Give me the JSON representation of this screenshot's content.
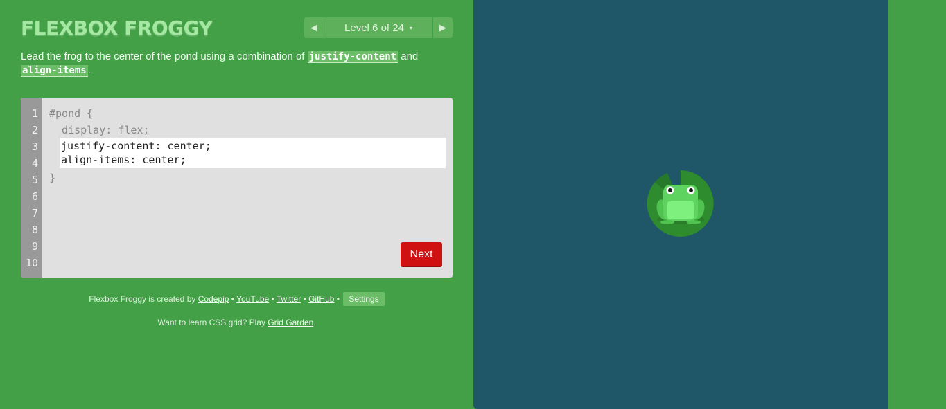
{
  "app": {
    "title": "FLEXBOX FROGGY",
    "level": {
      "label": "Level 6 of 24",
      "caret": "▾",
      "prev_icon": "◀",
      "next_icon": "▶"
    }
  },
  "instructions": {
    "text_1": "Lead the frog to the center of the pond using a combination of ",
    "code_1": "justify-content",
    "text_2": " and ",
    "code_2": "align-items",
    "text_3": "."
  },
  "editor": {
    "line_numbers": [
      "1",
      "2",
      "3",
      "4",
      "5",
      "6",
      "7",
      "8",
      "9",
      "10"
    ],
    "line_1": "#pond {",
    "line_2": "  display: flex;",
    "input_value": "justify-content: center;\nalign-items: center;",
    "line_5": "}",
    "next_label": "Next"
  },
  "footer": {
    "created_by": "Flexbox Froggy is created by ",
    "link_codepip": "Codepip",
    "sep": " • ",
    "link_youtube": "YouTube",
    "link_twitter": "Twitter",
    "link_github": "GitHub",
    "settings_label": "Settings",
    "grid_text": "Want to learn CSS grid? Play ",
    "grid_link": "Grid Garden",
    "grid_end": "."
  },
  "colors": {
    "background": "#43a047",
    "pond": "#1f5768",
    "lilypad": "#2e8b2e",
    "frog": "#5fd35f",
    "next_button": "#d01111"
  },
  "pond": {
    "frog_icon": "frog-icon",
    "lilypad_icon": "lilypad-icon"
  }
}
